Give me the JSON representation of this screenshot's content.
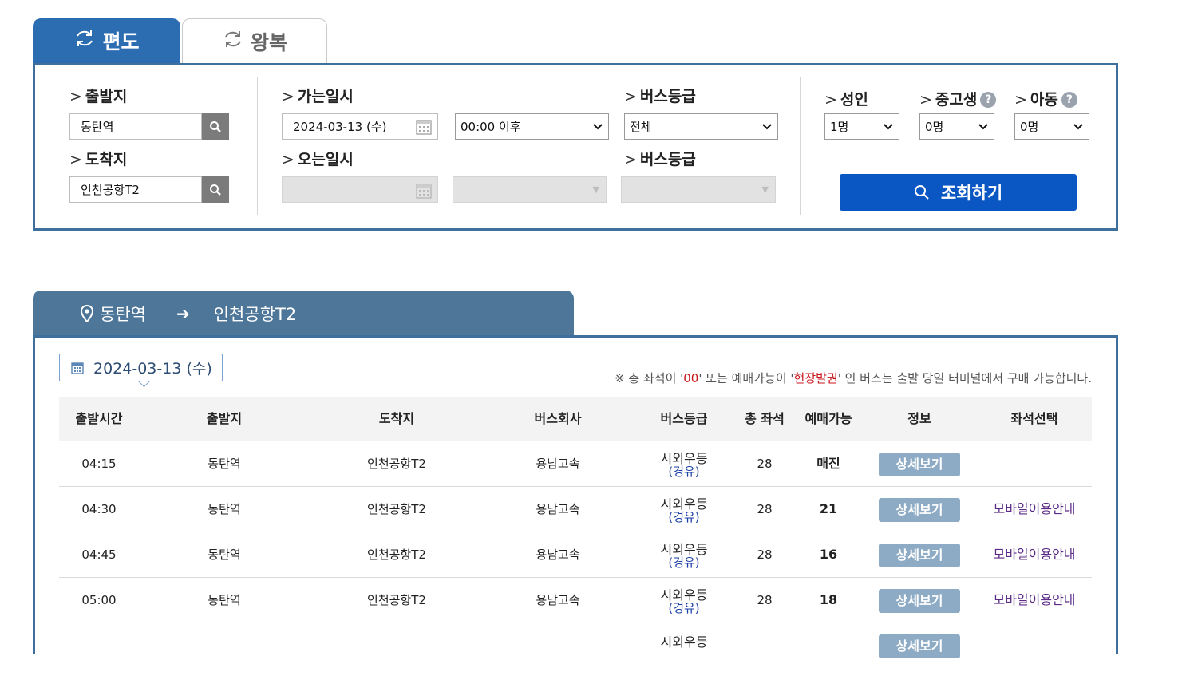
{
  "tabs": {
    "one_way": "편도",
    "round_trip": "왕복"
  },
  "search": {
    "departure_label": "출발지",
    "departure_value": "동탄역",
    "arrival_label": "도착지",
    "arrival_value": "인천공항T2",
    "go_date_label": "가는일시",
    "go_date_value": "2024-03-13 (수)",
    "go_time_value": "00:00 이후",
    "bus_grade_label": "버스등급",
    "bus_grade_value": "전체",
    "return_date_label": "오는일시",
    "return_grade_label": "버스등급",
    "adult_label": "성인",
    "adult_value": "1명",
    "student_label": "중고생",
    "student_value": "0명",
    "child_label": "아동",
    "child_value": "0명",
    "inquiry_button": "조회하기"
  },
  "route": {
    "from": "동탄역",
    "to": "인천공항T2"
  },
  "results": {
    "date": "2024-03-13 (수)",
    "notice_prefix": "※ 총 좌석이 '",
    "notice_zero": "00",
    "notice_mid": "' 또는 예매가능이 '",
    "notice_onsite": "현장발권",
    "notice_suffix": "' 인 버스는 출발 당일 터미널에서 구매 가능합니다.",
    "columns": [
      "출발시간",
      "출발지",
      "도착지",
      "버스회사",
      "버스등급",
      "총 좌석",
      "예매가능",
      "정보",
      "좌석선택"
    ],
    "rows": [
      {
        "time": "04:15",
        "from": "동탄역",
        "to": "인천공항T2",
        "company": "용남고속",
        "grade": "시외우등",
        "grade_sub": "(경유)",
        "seats": "28",
        "available": "매진",
        "info": "상세보기",
        "select": ""
      },
      {
        "time": "04:30",
        "from": "동탄역",
        "to": "인천공항T2",
        "company": "용남고속",
        "grade": "시외우등",
        "grade_sub": "(경유)",
        "seats": "28",
        "available": "21",
        "info": "상세보기",
        "select": "모바일이용안내"
      },
      {
        "time": "04:45",
        "from": "동탄역",
        "to": "인천공항T2",
        "company": "용남고속",
        "grade": "시외우등",
        "grade_sub": "(경유)",
        "seats": "28",
        "available": "16",
        "info": "상세보기",
        "select": "모바일이용안내"
      },
      {
        "time": "05:00",
        "from": "동탄역",
        "to": "인천공항T2",
        "company": "용남고속",
        "grade": "시외우등",
        "grade_sub": "(경유)",
        "seats": "28",
        "available": "18",
        "info": "상세보기",
        "select": "모바일이용안내"
      },
      {
        "time": "",
        "from": "",
        "to": "",
        "company": "",
        "grade": "시외우등",
        "grade_sub": "",
        "seats": "",
        "available": "",
        "info": "상세보기",
        "select": ""
      }
    ]
  }
}
